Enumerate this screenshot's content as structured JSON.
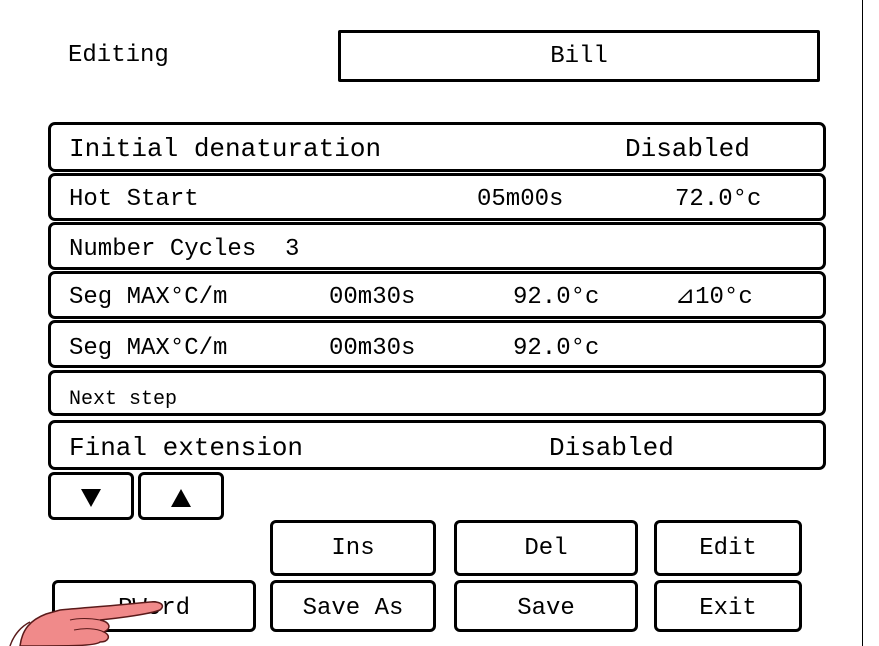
{
  "header": {
    "label": "Editing",
    "program_name": "Bill"
  },
  "rows": [
    {
      "c1": "Initial denaturation",
      "c4": "Disabled"
    },
    {
      "c1": "Hot Start",
      "c3": "05m00s",
      "c4": "72.0°c"
    },
    {
      "c1": "Number Cycles  3"
    },
    {
      "c1": "Seg MAX°C/m",
      "c2": "00m30s",
      "c3": "92.0°c",
      "c4": "⊿10°c"
    },
    {
      "c1": "Seg MAX°C/m",
      "c2": "00m30s",
      "c3": "92.0°c"
    },
    {
      "c1": "Next step"
    },
    {
      "c1": "Final extension",
      "c3": "Disabled"
    }
  ],
  "nav": {
    "down_icon": "triangle-down-icon",
    "up_icon": "triangle-up-icon"
  },
  "buttons": {
    "ins": "Ins",
    "del": "Del",
    "edit": "Edit",
    "pword": "PWord",
    "save_as": "Save As",
    "save": "Save",
    "exit": "Exit"
  }
}
